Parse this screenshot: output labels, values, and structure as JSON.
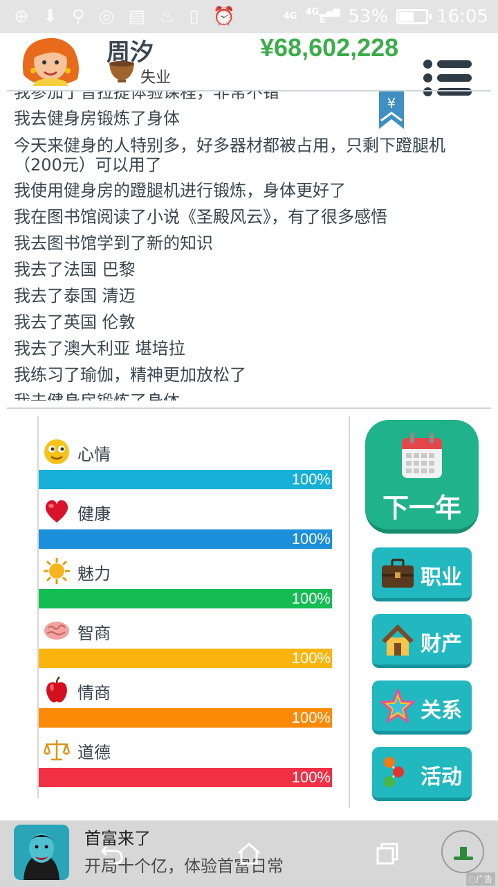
{
  "status_bar": {
    "network_top": "4G",
    "network_sig": "4G",
    "network_e": "E",
    "battery_percent": "53%",
    "battery_level": 0.53,
    "time": "16:05"
  },
  "header": {
    "name": "周汐",
    "job": "失业",
    "money": "¥68,602,228"
  },
  "log": {
    "bookmark_symbol": "¥",
    "lines": [
      "我参加了普拉提体验课程，非常不错",
      "我去健身房锻炼了身体",
      "今天来健身的人特别多，好多器材都被占用，只剩下蹬腿机（200元）可以用了",
      "我使用健身房的蹬腿机进行锻炼，身体更好了",
      "我在图书馆阅读了小说《圣殿风云》，有了很多感悟",
      "我去图书馆学到了新的知识",
      "我去了法国 巴黎",
      "我去了泰国 清迈",
      "我去了英国 伦敦",
      "我去了澳大利亚 堪培拉",
      "我练习了瑜伽，精神更加放松了",
      "我去健身房锻炼了身体"
    ]
  },
  "stats": [
    {
      "label": "心情",
      "value": "100%",
      "level": 1.0,
      "color": "#16afd8",
      "icon": "smiley-icon"
    },
    {
      "label": "健康",
      "value": "100%",
      "level": 1.0,
      "color": "#1c8fdb",
      "icon": "heart-icon"
    },
    {
      "label": "魅力",
      "value": "100%",
      "level": 1.0,
      "color": "#13bd52",
      "icon": "sun-icon"
    },
    {
      "label": "智商",
      "value": "100%",
      "level": 1.0,
      "color": "#fbb40d",
      "icon": "brain-icon"
    },
    {
      "label": "情商",
      "value": "100%",
      "level": 1.0,
      "color": "#fd8a06",
      "icon": "apple-icon"
    },
    {
      "label": "道德",
      "value": "100%",
      "level": 1.0,
      "color": "#ef3045",
      "icon": "scales-icon"
    }
  ],
  "actions": {
    "next_year": "下一年",
    "career": "职业",
    "property": "财产",
    "relations": "关系",
    "activities": "活动"
  },
  "ad": {
    "title": "首富来了",
    "description": "开局十个亿，体验首富日常",
    "tag": "广告"
  },
  "colors": {
    "money": "#3cac4a",
    "next_year_button": "#20b28b",
    "side_button": "#21b8c0"
  }
}
